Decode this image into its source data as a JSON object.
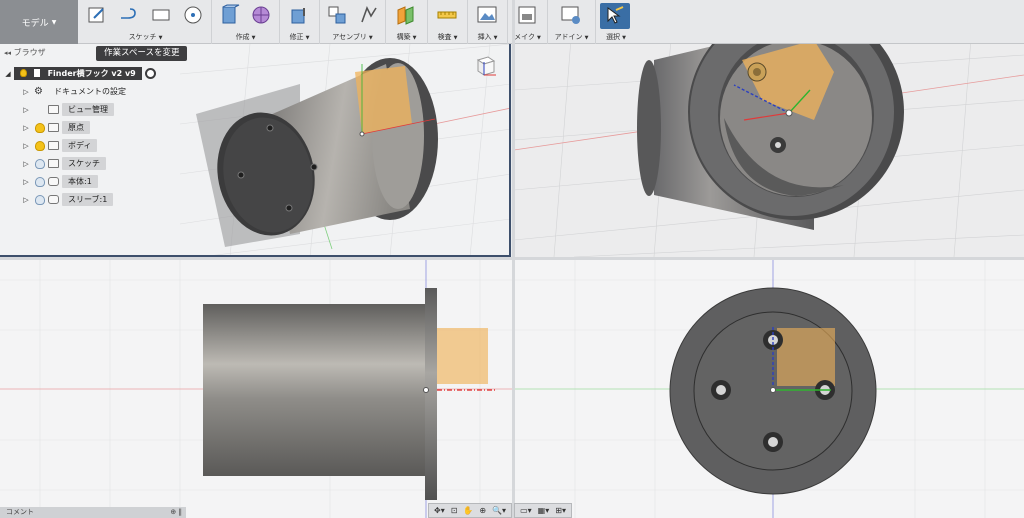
{
  "toolbar": {
    "workspace_label": "モデル",
    "groups": [
      {
        "label": "スケッチ",
        "icons": [
          "create-sketch-icon",
          "line-icon",
          "rectangle-icon",
          "circle-icon"
        ]
      },
      {
        "label": "作成",
        "icons": [
          "extrude-icon",
          "form-icon"
        ]
      },
      {
        "label": "修正",
        "icons": [
          "press-pull-icon"
        ]
      },
      {
        "label": "アセンブリ",
        "icons": [
          "component-icon",
          "joint-icon"
        ]
      },
      {
        "label": "構築",
        "icons": [
          "offset-plane-icon"
        ]
      },
      {
        "label": "検査",
        "icons": [
          "measure-icon"
        ]
      },
      {
        "label": "挿入",
        "icons": [
          "insert-image-icon"
        ]
      },
      {
        "label": "メイク",
        "icons": [
          "3d-print-icon"
        ]
      },
      {
        "label": "アドイン",
        "icons": [
          "scripts-icon"
        ]
      },
      {
        "label": "選択",
        "icons": [
          "select-icon"
        ]
      }
    ]
  },
  "browser": {
    "title": "ブラウザ",
    "tooltip": "作業スペースを変更",
    "root": "Finder横フック v2 v9",
    "items": [
      {
        "label": "ドキュメントの設定",
        "icon": "gear-icon"
      },
      {
        "label": "ビュー管理",
        "icon": "folder-icon"
      },
      {
        "label": "原点",
        "icon": "folder-icon",
        "visible": true
      },
      {
        "label": "ボディ",
        "icon": "folder-icon",
        "visible": true
      },
      {
        "label": "スケッチ",
        "icon": "folder-icon",
        "visible": false
      },
      {
        "label": "本体:1",
        "icon": "body-icon",
        "visible": false
      },
      {
        "label": "スリーブ:1",
        "icon": "body-icon",
        "visible": false
      }
    ]
  },
  "comment_bar": {
    "label": "コメント"
  },
  "colors": {
    "toolbar_bg": "#e7e8ea",
    "workspace_button": "#8b8e92",
    "active_viewport_border": "#3d4f6b",
    "sketch_plane": "#f0b35a",
    "x_axis": "#e03a3a",
    "y_axis": "#2fb52f",
    "z_axis": "#2b3fbf"
  }
}
